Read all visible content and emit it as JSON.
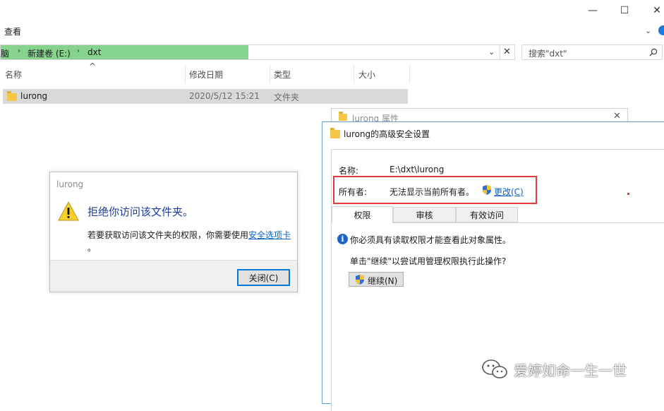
{
  "ribbon": {
    "view_tab": "查看"
  },
  "address": {
    "crumbs": [
      "脑",
      "新建卷 (E:)",
      "dxt"
    ],
    "search_placeholder": "搜索\"dxt\""
  },
  "columns": [
    "名称",
    "修改日期",
    "类型",
    "大小"
  ],
  "rows": [
    {
      "name": "lurong",
      "date": "2020/5/12 15:21",
      "type": "文件夹"
    }
  ],
  "denied_dialog": {
    "title": "lurong",
    "heading": "拒绝你访问该文件夹。",
    "message": "若要获取访问该文件夹的权限，你需要使用",
    "link": "安全选项卡",
    "tail": "。",
    "close_button": "关闭(C)"
  },
  "properties_dialog": {
    "title": "lurong 属性"
  },
  "security_dialog": {
    "title": "lurong的高级安全设置",
    "name_label": "名称:",
    "name_value": "E:\\dxt\\lurong",
    "owner_label": "所有者:",
    "owner_value": "无法显示当前所有者。",
    "change_link": "更改(C)",
    "tabs": [
      "权限",
      "审核",
      "有效访问"
    ],
    "info_text": "你必须具有读取权限才能查看此对象属性。",
    "prompt_text": "单击\"继续\"以尝试用管理权限执行此操作?",
    "continue_button": "继续(N)"
  },
  "watermark": {
    "text": "爱婷如命一生一世"
  }
}
